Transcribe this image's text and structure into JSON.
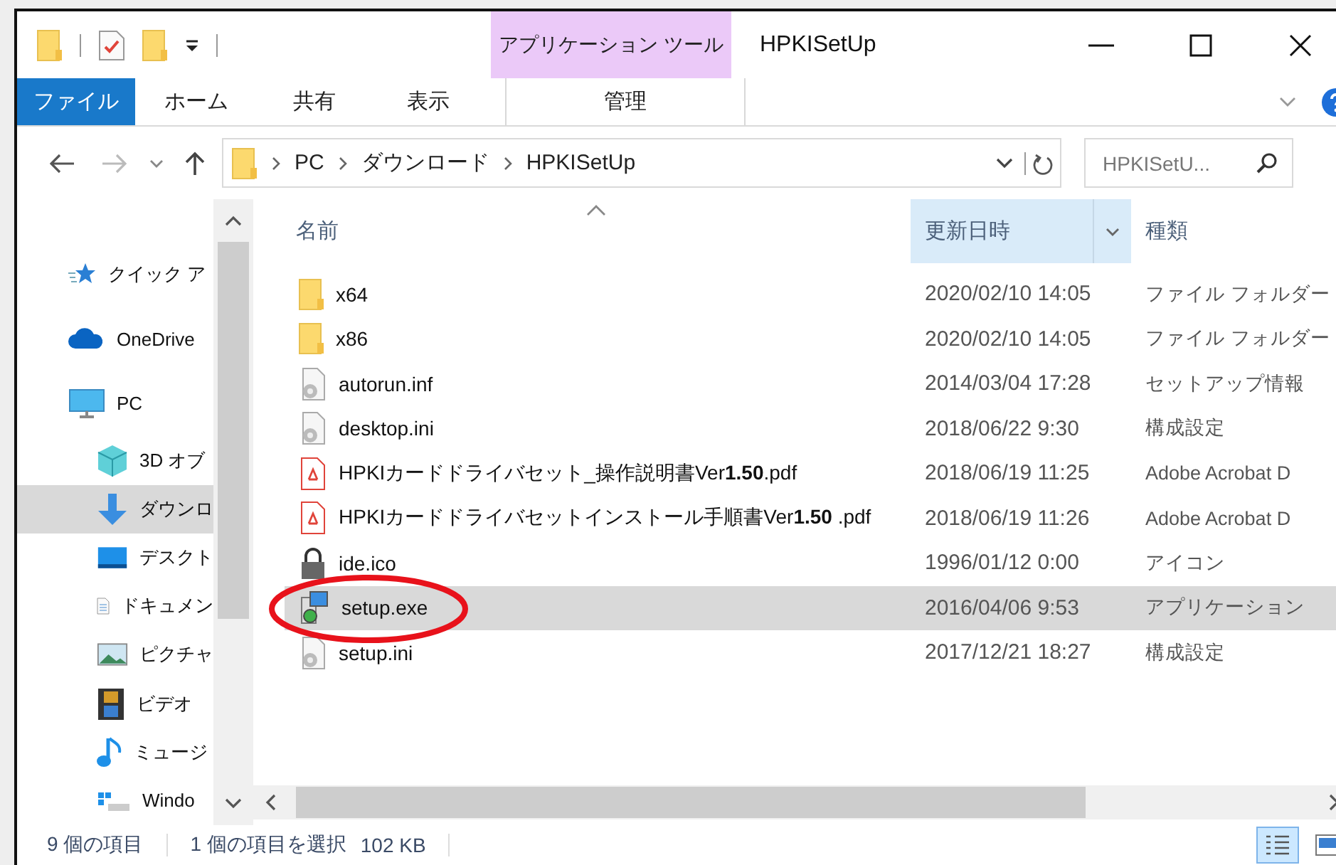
{
  "window": {
    "title": "HPKISetUp"
  },
  "ribbon": {
    "context_group": "アプリケーション ツール",
    "tabs": [
      {
        "label": "ファイル",
        "kind": "file"
      },
      {
        "label": "ホーム",
        "kind": "tab"
      },
      {
        "label": "共有",
        "kind": "tab"
      },
      {
        "label": "表示",
        "kind": "tab"
      },
      {
        "label": "管理",
        "kind": "context"
      }
    ]
  },
  "address": {
    "crumbs": [
      "PC",
      "ダウンロード",
      "HPKISetUp"
    ]
  },
  "search": {
    "placeholder": "HPKISetU..."
  },
  "nav": {
    "items": [
      {
        "label": "クイック ア",
        "kind": "quick",
        "selected": false
      },
      {
        "label": "OneDrive",
        "kind": "cloud",
        "selected": false
      },
      {
        "label": "PC",
        "kind": "pc",
        "selected": false,
        "children": [
          {
            "label": "3D オブ",
            "kind": "cube",
            "selected": false
          },
          {
            "label": "ダウンロ",
            "kind": "download",
            "selected": true
          },
          {
            "label": "デスクト",
            "kind": "desktop",
            "selected": false
          },
          {
            "label": "ドキュメン",
            "kind": "document",
            "selected": false
          },
          {
            "label": "ピクチャ",
            "kind": "pictures",
            "selected": false
          },
          {
            "label": "ビデオ",
            "kind": "video",
            "selected": false
          },
          {
            "label": "ミュージ",
            "kind": "music",
            "selected": false
          },
          {
            "label": "Windo",
            "kind": "drive",
            "selected": false
          }
        ]
      }
    ]
  },
  "table": {
    "columns": [
      {
        "label": "名前",
        "sorted": true,
        "hovered": false
      },
      {
        "label": "更新日時",
        "sorted": false,
        "hovered": true
      },
      {
        "label": "種類",
        "sorted": false,
        "hovered": false
      }
    ],
    "rows": [
      {
        "name": "x64",
        "date": "2020/02/10 14:05",
        "type": "ファイル フォルダー",
        "kind": "folder",
        "selected": false,
        "circled": false
      },
      {
        "name": "x86",
        "date": "2020/02/10 14:05",
        "type": "ファイル フォルダー",
        "kind": "folder",
        "selected": false,
        "circled": false
      },
      {
        "name": "autorun.inf",
        "date": "2014/03/04 17:28",
        "type": "セットアップ情報",
        "kind": "settings",
        "selected": false,
        "circled": false
      },
      {
        "name": "desktop.ini",
        "date": "2018/06/22 9:30",
        "type": "構成設定",
        "kind": "settings",
        "selected": false,
        "circled": false
      },
      {
        "name": "HPKIカードドライバセット_操作説明書Ver**1.50**.pdf",
        "date": "2018/06/19 11:25",
        "type": "Adobe Acrobat D",
        "kind": "pdf",
        "selected": false,
        "circled": false
      },
      {
        "name": "HPKIカードドライバセットインストール手順書Ver**1.50** .pdf",
        "date": "2018/06/19 11:26",
        "type": "Adobe Acrobat D",
        "kind": "pdf",
        "selected": false,
        "circled": false
      },
      {
        "name": "ide.ico",
        "date": "1996/01/12 0:00",
        "type": "アイコン",
        "kind": "icon",
        "selected": false,
        "circled": false
      },
      {
        "name": "setup.exe",
        "date": "2016/04/06 9:53",
        "type": "アプリケーション",
        "kind": "app",
        "selected": true,
        "circled": true
      },
      {
        "name": "setup.ini",
        "date": "2017/12/21 18:27",
        "type": "構成設定",
        "kind": "settings",
        "selected": false,
        "circled": false
      }
    ]
  },
  "status_bar": {
    "count": "9 個の項目",
    "selection": "1 個の項目を選択",
    "size": "102 KB",
    "views": [
      {
        "kind": "details",
        "selected": true
      },
      {
        "kind": "tiles",
        "selected": false
      }
    ]
  }
}
